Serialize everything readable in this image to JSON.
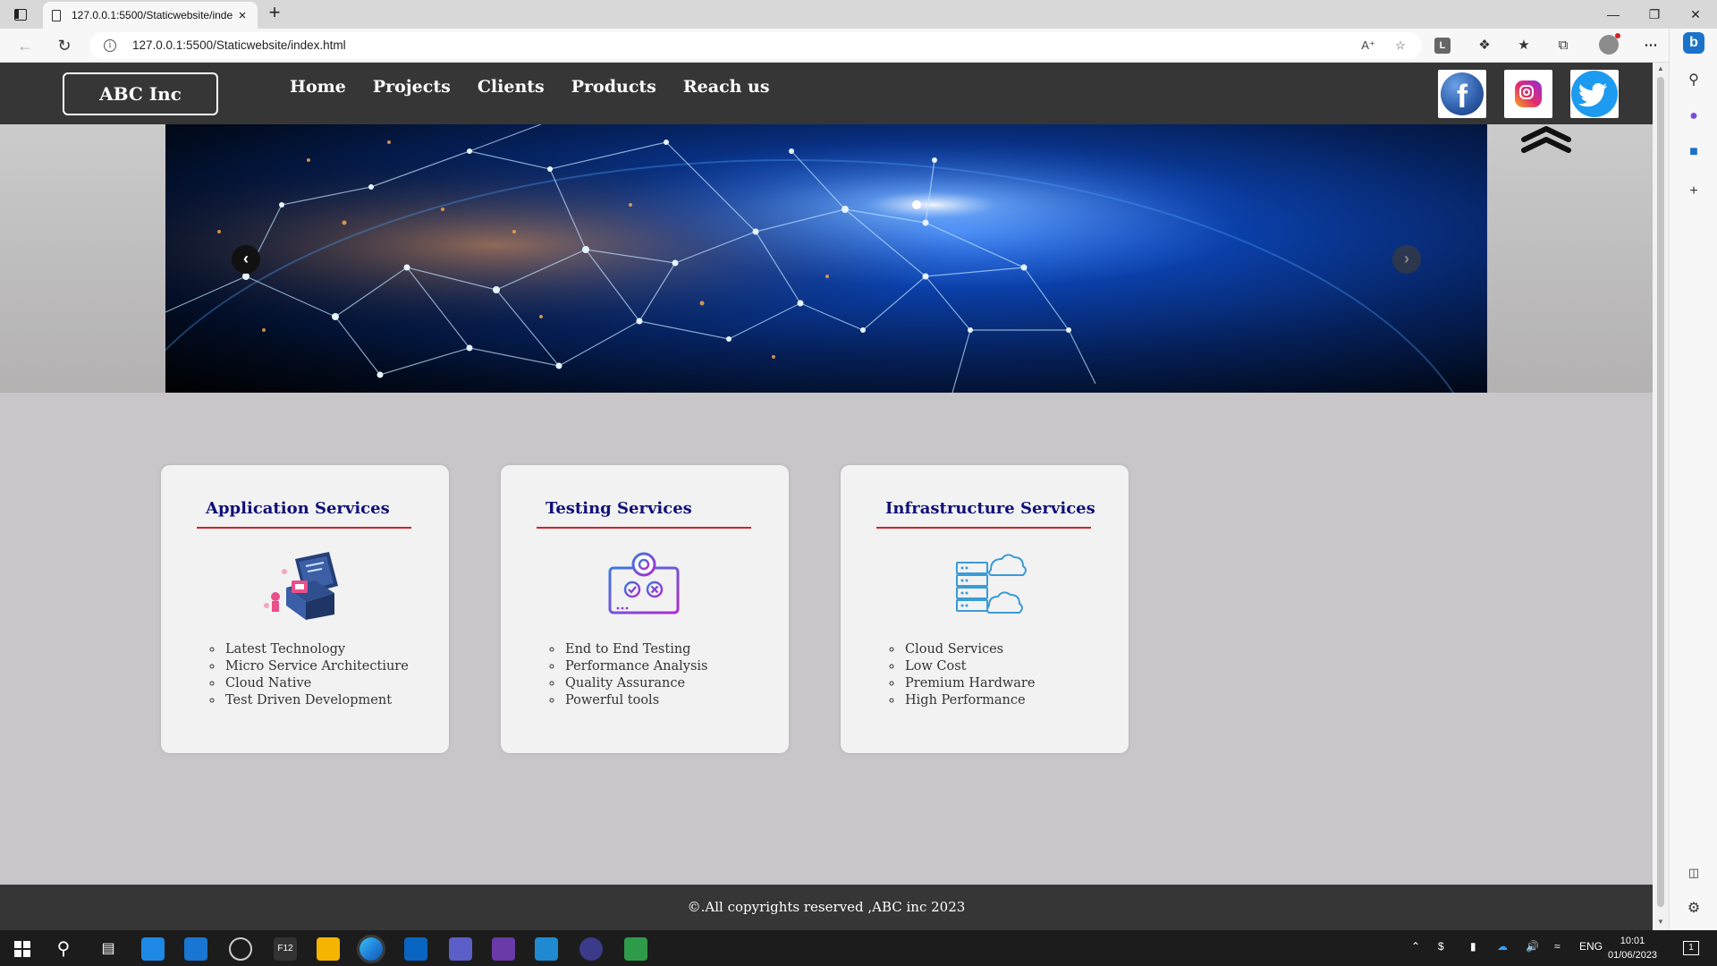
{
  "browser": {
    "tab_title": "127.0.0.1:5500/Staticwebsite/inde",
    "url": "127.0.0.1:5500/Staticwebsite/index.html"
  },
  "site": {
    "logo": "ABC Inc",
    "nav": [
      "Home",
      "Projects",
      "Clients",
      "Products",
      "Reach us"
    ],
    "social": [
      "facebook-icon",
      "instagram-icon",
      "twitter-icon"
    ]
  },
  "cards": [
    {
      "title": "Application Services",
      "icon": "application-services-illustration",
      "items": [
        "Latest Technology",
        "Micro Service Architectiure",
        "Cloud Native",
        "Test Driven Development"
      ]
    },
    {
      "title": "Testing Services",
      "icon": "testing-services-illustration",
      "items": [
        "End to End Testing",
        "Performance Analysis",
        "Quality Assurance",
        "Powerful tools"
      ]
    },
    {
      "title": "Infrastructure Services",
      "icon": "infrastructure-services-illustration",
      "items": [
        "Cloud Services",
        "Low Cost",
        "Premium Hardware",
        "High Performance"
      ]
    }
  ],
  "footer": "©.All copyrights reserved ,ABC inc 2023",
  "taskbar": {
    "lang": "ENG",
    "time": "10:01",
    "date": "01/06/2023",
    "notification_count": "1"
  },
  "colors": {
    "header_bg": "#363636",
    "card_title": "#10107a",
    "card_underline": "#d21f2b",
    "page_bg": "#c9c6c9"
  }
}
